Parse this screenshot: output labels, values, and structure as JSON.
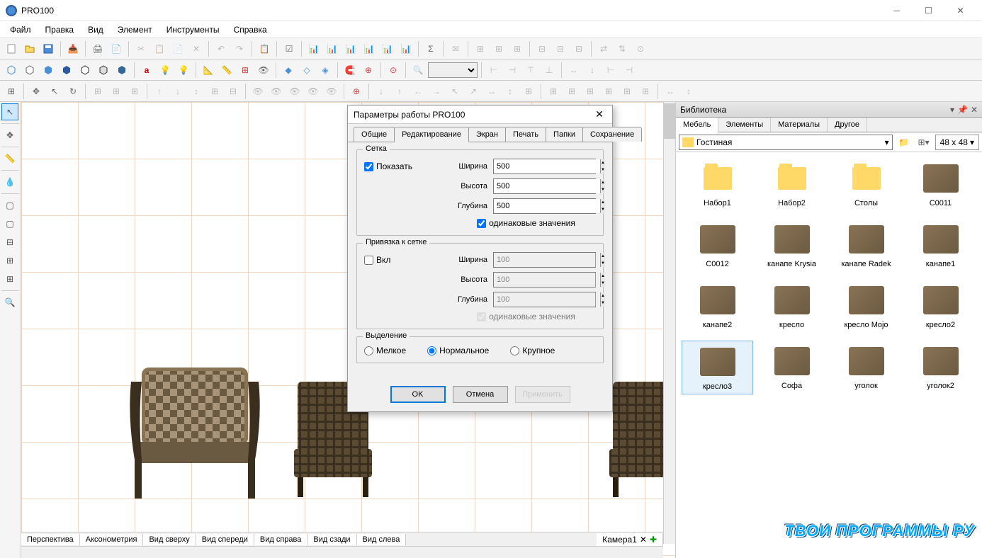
{
  "app": {
    "title": "PRO100"
  },
  "menu": {
    "items": [
      "Файл",
      "Правка",
      "Вид",
      "Элемент",
      "Инструменты",
      "Справка"
    ]
  },
  "viewTabs": [
    "Перспектива",
    "Аксонометрия",
    "Вид сверху",
    "Вид спереди",
    "Вид справа",
    "Вид сзади",
    "Вид слева"
  ],
  "cameraTab": "Камера1",
  "library": {
    "title": "Библиотека",
    "tabs": [
      "Мебель",
      "Элементы",
      "Материалы",
      "Другое"
    ],
    "folder": "Гостиная",
    "thumbSize": "48 x  48",
    "items": [
      {
        "label": "Набор1",
        "type": "folder"
      },
      {
        "label": "Набор2",
        "type": "folder"
      },
      {
        "label": "Столы",
        "type": "folder"
      },
      {
        "label": "C0011",
        "type": "furn"
      },
      {
        "label": "C0012",
        "type": "furn"
      },
      {
        "label": "канапе Krysia",
        "type": "furn"
      },
      {
        "label": "канапе Radek",
        "type": "furn"
      },
      {
        "label": "канапе1",
        "type": "furn"
      },
      {
        "label": "канапе2",
        "type": "furn"
      },
      {
        "label": "кресло",
        "type": "furn"
      },
      {
        "label": "кресло Mojo",
        "type": "furn"
      },
      {
        "label": "кресло2",
        "type": "furn"
      },
      {
        "label": "кресло3",
        "type": "furn",
        "selected": true
      },
      {
        "label": "Софа",
        "type": "furn"
      },
      {
        "label": "уголок",
        "type": "furn"
      },
      {
        "label": "уголок2",
        "type": "furn"
      }
    ]
  },
  "dialog": {
    "title": "Параметры работы PRO100",
    "tabs": [
      "Общие",
      "Редактирование",
      "Экран",
      "Печать",
      "Папки",
      "Сохранение"
    ],
    "activeTab": "Редактирование",
    "grid": {
      "groupTitle": "Сетка",
      "showLabel": "Показать",
      "show": true,
      "widthLabel": "Ширина",
      "width": "500",
      "heightLabel": "Высота",
      "height": "500",
      "depthLabel": "Глубина",
      "depth": "500",
      "sameLabel": "одинаковые значения",
      "same": true
    },
    "snap": {
      "groupTitle": "Привязка к сетке",
      "enableLabel": "Вкл",
      "enable": false,
      "widthLabel": "Ширина",
      "width": "100",
      "heightLabel": "Высота",
      "height": "100",
      "depthLabel": "Глубина",
      "depth": "100",
      "sameLabel": "одинаковые значения",
      "same": true
    },
    "selection": {
      "groupTitle": "Выделение",
      "small": "Мелкое",
      "normal": "Нормальное",
      "large": "Крупное",
      "value": "normal"
    },
    "buttons": {
      "ok": "OK",
      "cancel": "Отмена",
      "apply": "Применить"
    }
  },
  "watermark": "ТВОИ ПРОГРАММЫ РУ"
}
